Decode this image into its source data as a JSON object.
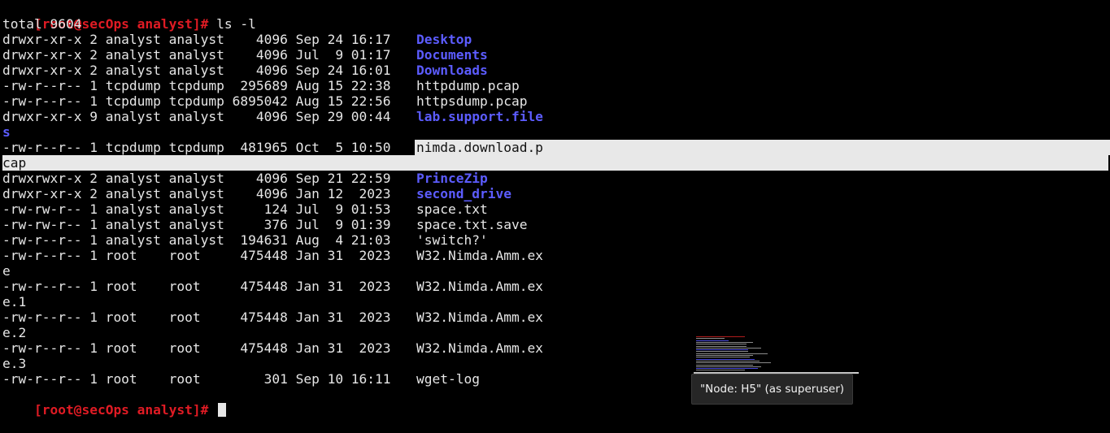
{
  "terminal": {
    "prompt": "[root@secOps analyst]# ",
    "command": "ls -l",
    "total": "total 9604",
    "entries": [
      {
        "meta": "drwxr-xr-x 2 analyst analyst    4096 Sep 24 16:17  ",
        "name": "Desktop",
        "type": "dir"
      },
      {
        "meta": "drwxr-xr-x 2 analyst analyst    4096 Jul  9 01:17  ",
        "name": "Documents",
        "type": "dir"
      },
      {
        "meta": "drwxr-xr-x 2 analyst analyst    4096 Sep 24 16:01  ",
        "name": "Downloads",
        "type": "dir"
      },
      {
        "meta": "-rw-r--r-- 1 tcpdump tcpdump  295689 Aug 15 22:38  ",
        "name": "httpdump.pcap",
        "type": "file"
      },
      {
        "meta": "-rw-r--r-- 1 tcpdump tcpdump 6895042 Aug 15 22:56  ",
        "name": "httpsdump.pcap",
        "type": "file"
      },
      {
        "meta": "drwxr-xr-x 9 analyst analyst    4096 Sep 29 00:44  ",
        "name": "lab.support.file",
        "wrap": "s",
        "type": "dir"
      },
      {
        "meta": "-rw-r--r-- 1 tcpdump tcpdump  481965 Oct  5 10:50  ",
        "name": "nimda.download.p",
        "wrap": "cap",
        "type": "file",
        "selected": true
      },
      {
        "meta": "drwxrwxr-x 2 analyst analyst    4096 Sep 21 22:59  ",
        "name": "PrinceZip",
        "type": "dir"
      },
      {
        "meta": "drwxr-xr-x 2 analyst analyst    4096 Jan 12  2023  ",
        "name": "second_drive",
        "type": "dir"
      },
      {
        "meta": "-rw-rw-r-- 1 analyst analyst     124 Jul  9 01:53  ",
        "name": "space.txt",
        "type": "file"
      },
      {
        "meta": "-rw-rw-r-- 1 analyst analyst     376 Jul  9 01:39  ",
        "name": "space.txt.save",
        "type": "file"
      },
      {
        "meta": "-rw-r--r-- 1 analyst analyst  194631 Aug  4 21:03 ",
        "name": "'switch?'",
        "type": "file"
      },
      {
        "meta": "-rw-r--r-- 1 root    root     475448 Jan 31  2023  ",
        "name": "W32.Nimda.Amm.ex",
        "wrap": "e",
        "type": "file"
      },
      {
        "meta": "-rw-r--r-- 1 root    root     475448 Jan 31  2023  ",
        "name": "W32.Nimda.Amm.ex",
        "wrap": "e.1",
        "type": "file"
      },
      {
        "meta": "-rw-r--r-- 1 root    root     475448 Jan 31  2023  ",
        "name": "W32.Nimda.Amm.ex",
        "wrap": "e.2",
        "type": "file"
      },
      {
        "meta": "-rw-r--r-- 1 root    root     475448 Jan 31  2023  ",
        "name": "W32.Nimda.Amm.ex",
        "wrap": "e.3",
        "type": "file"
      },
      {
        "meta": "-rw-r--r-- 1 root    root        301 Sep 10 16:11  ",
        "name": "wget-log",
        "type": "file"
      }
    ]
  },
  "tooltip": {
    "text": "\"Node: H5\" (as superuser)"
  },
  "colors": {
    "background": "#000000",
    "foreground": "#e6e6e6",
    "prompt": "#e01b24",
    "directory": "#5c5cff",
    "selection": "#e8e8e8"
  },
  "icons": {
    "cursor": "block-cursor-icon",
    "thumbnail": "window-thumbnail-icon"
  }
}
